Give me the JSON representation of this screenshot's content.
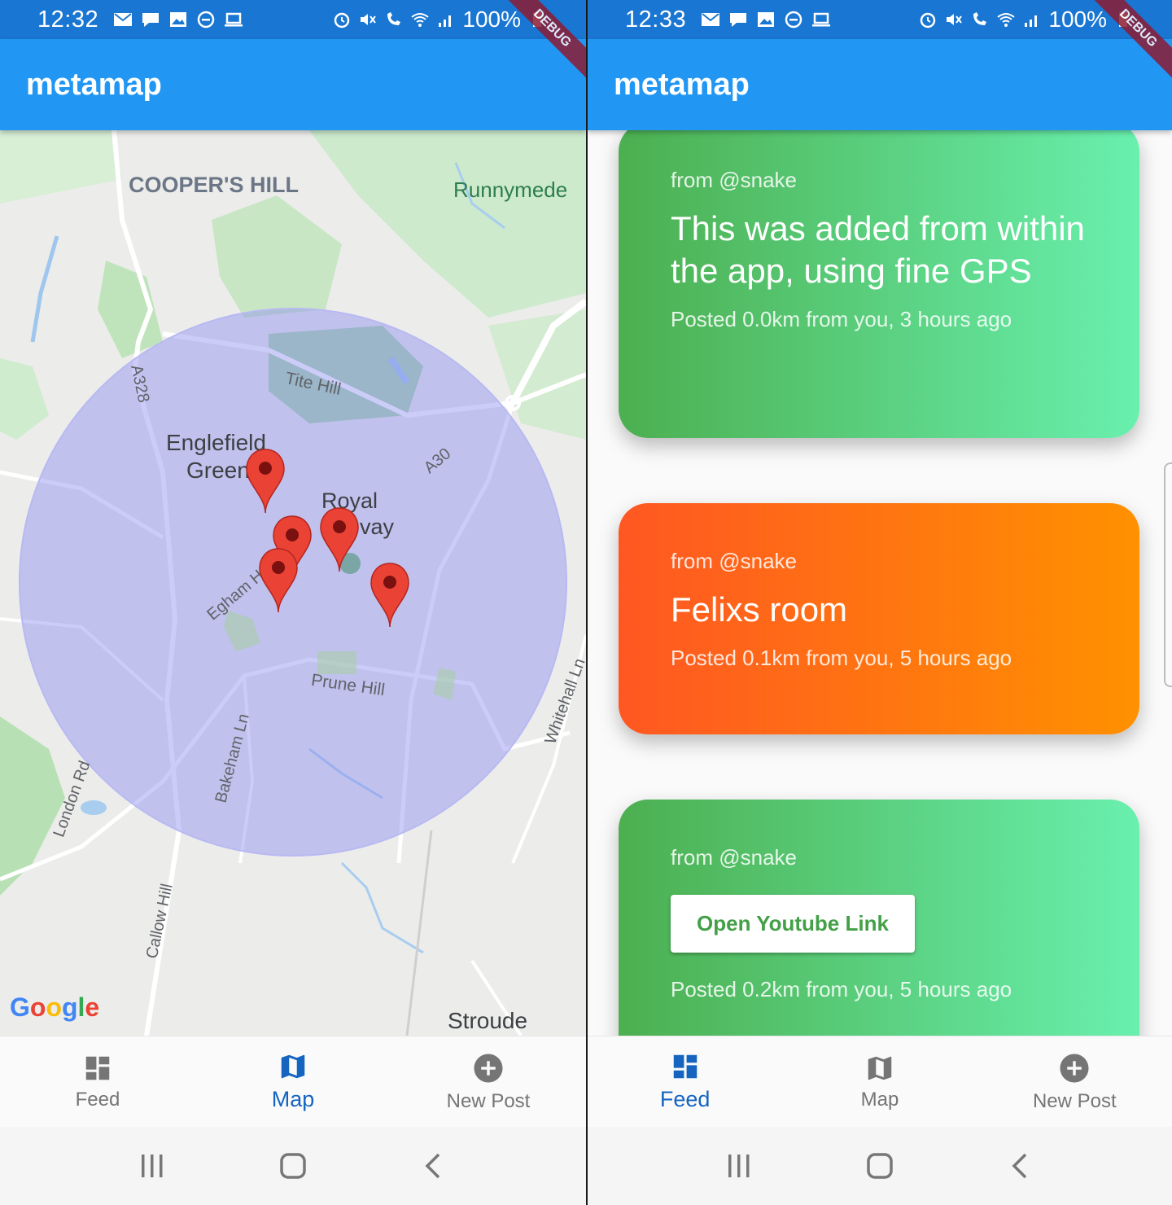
{
  "left": {
    "status": {
      "time": "12:32",
      "battery": "100%"
    },
    "debug_banner": "DEBUG",
    "app_title": "metamap",
    "map_labels": {
      "coopers_hill": "COOPER'S HILL",
      "runnymede": "Runnymede",
      "a328": "A328",
      "tite_hill": "Tite Hill",
      "englefield": "Englefield",
      "green": "Green",
      "royal": "Royal",
      "way": "vay",
      "a30": "A30",
      "egham": "Egham H",
      "prune_hill": "Prune Hill",
      "whitehall": "Whitehall Ln",
      "bakeham": "Bakeham Ln",
      "london_rd": "London Rd",
      "callow_hill": "Callow Hill",
      "stroude": "Stroude"
    },
    "google_logo": [
      "G",
      "o",
      "o",
      "g",
      "l",
      "e"
    ],
    "nav": [
      {
        "label": "Feed",
        "icon": "dashboard-icon"
      },
      {
        "label": "Map",
        "icon": "map-icon",
        "active": true
      },
      {
        "label": "New Post",
        "icon": "add-circle-icon"
      }
    ]
  },
  "right": {
    "status": {
      "time": "12:33",
      "battery": "100%"
    },
    "debug_banner": "DEBUG",
    "app_title": "metamap",
    "posts": [
      {
        "from": "from @snake",
        "title": "This was added from within the app, using fine GPS",
        "meta": "Posted 0.0km from you, 3 hours ago",
        "color": "green"
      },
      {
        "from": "from @snake",
        "title": "Felixs room",
        "meta": "Posted 0.1km from you, 5 hours ago",
        "color": "orange"
      },
      {
        "from": "from @snake",
        "button": "Open Youtube Link",
        "meta": "Posted 0.2km from you, 5 hours ago",
        "color": "green"
      }
    ],
    "nav": [
      {
        "label": "Feed",
        "icon": "dashboard-icon",
        "active": true
      },
      {
        "label": "Map",
        "icon": "map-icon"
      },
      {
        "label": "New Post",
        "icon": "add-circle-icon"
      }
    ]
  },
  "colors": {
    "appbar": "#2196f3",
    "statusbar": "#1976d2",
    "active_nav": "#1565c0",
    "marker": "#ea4335",
    "circle": "#8c8ff0"
  }
}
